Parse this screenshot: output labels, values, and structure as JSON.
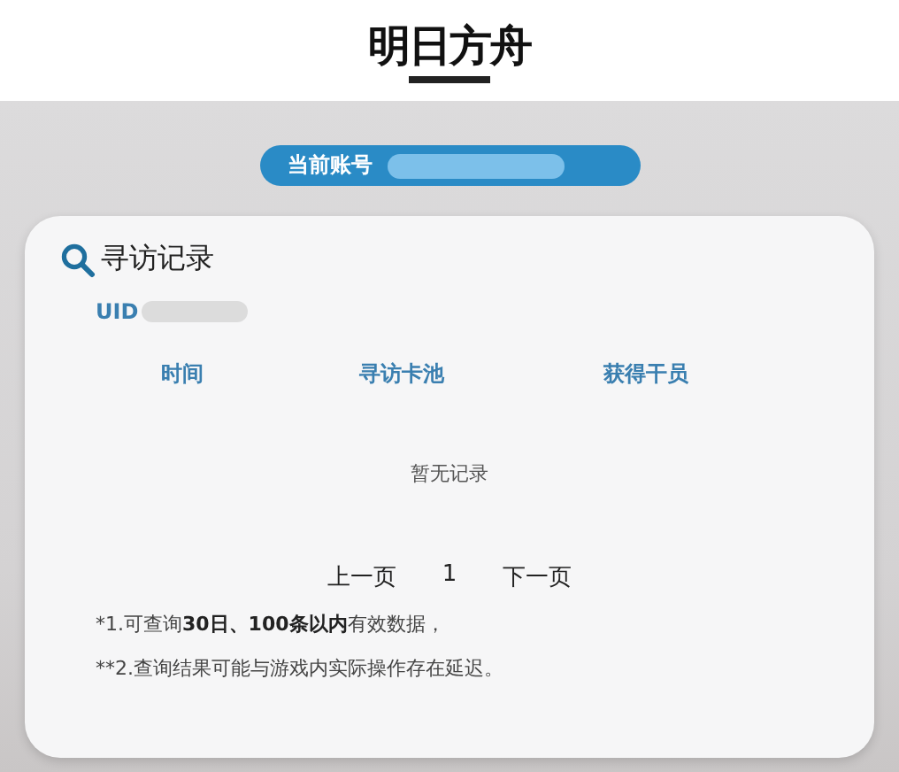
{
  "header": {
    "logo": "明日方舟"
  },
  "account": {
    "label": "当前账号"
  },
  "record": {
    "title": "寻访记录",
    "uid_label": "UID",
    "columns": [
      "时间",
      "寻访卡池",
      "获得干员"
    ],
    "empty": "暂无记录",
    "pagination": {
      "prev": "上一页",
      "page": "1",
      "next": "下一页"
    },
    "notes": [
      "*1.可查询**30日、100条以内**有效数据，",
      "**2.查询结果可能与游戏内实际操作存在延迟。"
    ]
  }
}
